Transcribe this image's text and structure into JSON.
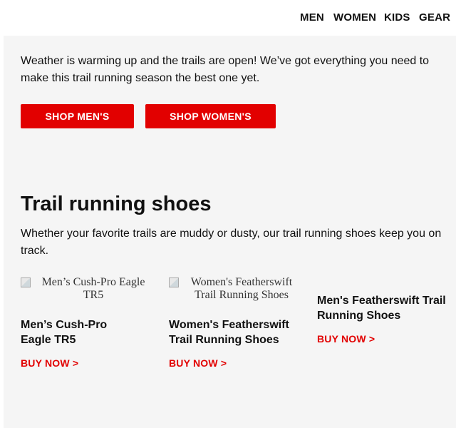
{
  "nav": {
    "items": [
      "MEN",
      "WOMEN",
      "KIDS",
      "GEAR"
    ]
  },
  "intro": {
    "text": "Weather is warming up and the trails are open! We’ve got everything you need to make this trail running season the best one yet."
  },
  "buttons": {
    "shop_mens": "SHOP MEN'S",
    "shop_womens": "SHOP WOMEN'S"
  },
  "section": {
    "title": "Trail running shoes",
    "description": "Whether your favorite trails are muddy or dusty, our trail running shoes keep you on track."
  },
  "products": [
    {
      "image_alt": "Men’s Cush-Pro Eagle TR5",
      "name": "Men’s Cush-Pro Eagle TR5",
      "cta": "BUY NOW >"
    },
    {
      "image_alt": "Women's Featherswift Trail Running Shoes",
      "name": "Women's Featherswift Trail Running Shoes",
      "cta": "BUY NOW >"
    },
    {
      "image_alt": "",
      "name": "Men's Featherswift Trail Running Shoes",
      "cta": "BUY NOW >"
    }
  ],
  "colors": {
    "accent": "#e20000",
    "background": "#f5f5f5",
    "text": "#111111"
  },
  "icons": {
    "broken_image": "broken-image-icon"
  }
}
